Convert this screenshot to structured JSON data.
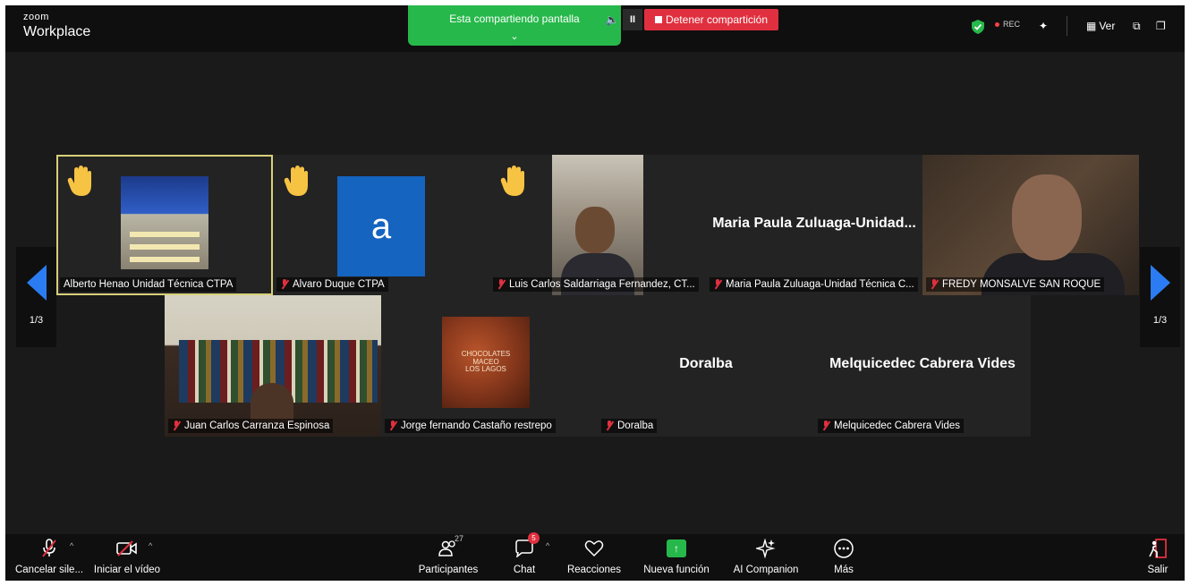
{
  "app": {
    "brand_small": "zoom",
    "brand_large": "Workplace"
  },
  "share_bar": {
    "status": "Esta compartiendo pantalla",
    "pause_label": "II",
    "stop_label": "Detener compartición"
  },
  "top_right": {
    "rec_label": "REC",
    "view_label": "Ver"
  },
  "pager": {
    "left_page": "1/3",
    "right_page": "1/3"
  },
  "participants": [
    {
      "name": "Alberto Henao Unidad Técnica CTPA",
      "hand_raised": true,
      "muted": false,
      "speaking": true
    },
    {
      "name": "Alvaro Duque CTPA",
      "hand_raised": true,
      "muted": true,
      "avatar_letter": "a"
    },
    {
      "name": "Luis Carlos Saldarriaga Fernandez, CT...",
      "hand_raised": true,
      "muted": true
    },
    {
      "name": "Maria Paula Zuluaga-Unidad Técnica C...",
      "display_name": "Maria Paula Zuluaga-Unidad...",
      "muted": true
    },
    {
      "name": "FREDY MONSALVE SAN ROQUE",
      "muted": true
    },
    {
      "name": "Juan Carlos Carranza Espinosa",
      "muted": true
    },
    {
      "name": "Jorge fernando Castaño restrepo",
      "muted": true,
      "picture_text": [
        "CHOCOLATES",
        "MACEO",
        "LOS LAGOS"
      ]
    },
    {
      "name": "Doralba",
      "display_name": "Doralba",
      "muted": true
    },
    {
      "name": "Melquicedec Cabrera Vides",
      "display_name": "Melquicedec Cabrera Vides",
      "muted": true
    }
  ],
  "toolbar": {
    "unmute": "Cancelar sile...",
    "video": "Iniciar el vídeo",
    "participants": "Participantes",
    "participants_count": "27",
    "chat": "Chat",
    "chat_badge": "5",
    "reactions": "Reacciones",
    "new_feature": "Nueva función",
    "ai": "AI Companion",
    "more": "Más",
    "leave": "Salir"
  },
  "colors": {
    "accent_blue": "#2b7cf2",
    "share_green": "#27b84b",
    "stop_red": "#e0303f",
    "speaking_border": "#d8d07a"
  }
}
